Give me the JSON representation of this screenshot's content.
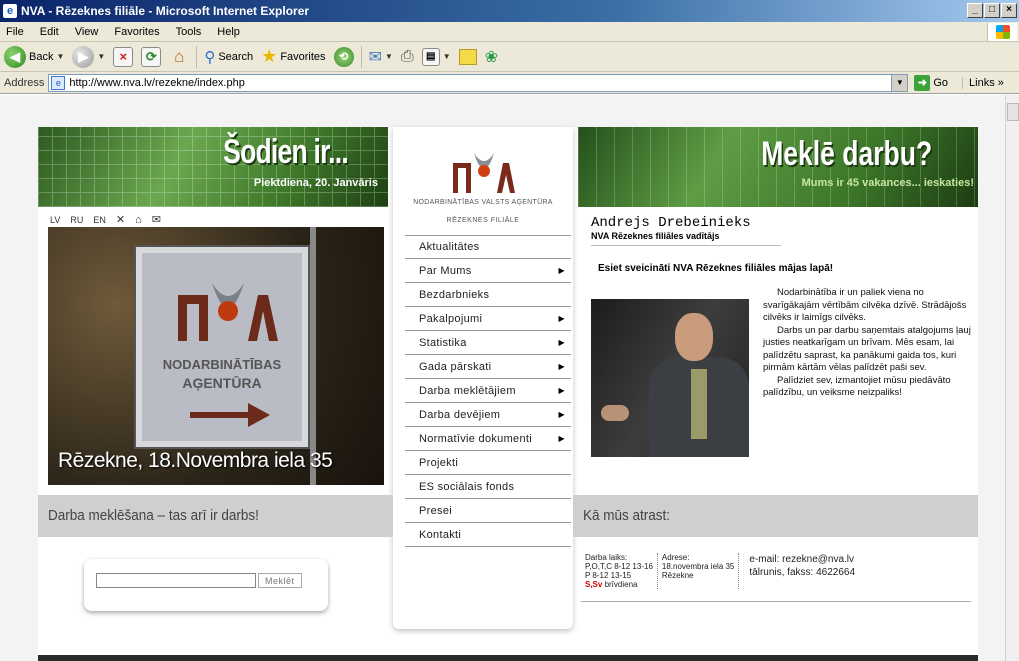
{
  "window": {
    "title": "NVA - Rēzeknes filiāle - Microsoft Internet Explorer",
    "controls": [
      "_",
      "□",
      "×"
    ]
  },
  "menubar": [
    "File",
    "Edit",
    "View",
    "Favorites",
    "Tools",
    "Help"
  ],
  "toolbar": {
    "back": "Back",
    "search": "Search",
    "favorites": "Favorites"
  },
  "address": {
    "label": "Address",
    "url": "http://www.nva.lv/rezekne/index.php",
    "go": "Go",
    "links": "Links"
  },
  "header_left": {
    "title": "Šodien ir...",
    "date": "Piektdiena, 20. Janvāris"
  },
  "header_right": {
    "title": "Meklē darbu?",
    "tagline": "Mums ir 45 vakances... ieskaties!"
  },
  "languages": [
    "LV",
    "RU",
    "EN"
  ],
  "logo": {
    "agency": "NODARBINĀTĪBAS VALSTS AĢENTŪRA",
    "branch": "RĒZEKNES FILIĀLE"
  },
  "sign": {
    "line1": "NODARBINĀTĪBAS",
    "line2": "AĢENTŪRA",
    "caption": "Rēzekne, 18.Novembra iela 35"
  },
  "nav": [
    {
      "label": "Aktualitātes",
      "submenu": false
    },
    {
      "label": "Par Mums",
      "submenu": true
    },
    {
      "label": "Bezdarbnieks",
      "submenu": false
    },
    {
      "label": "Pakalpojumi",
      "submenu": true
    },
    {
      "label": "Statistika",
      "submenu": true
    },
    {
      "label": "Gada pārskati",
      "submenu": true
    },
    {
      "label": "Darba meklētājiem",
      "submenu": true
    },
    {
      "label": "Darba devējiem",
      "submenu": true
    },
    {
      "label": "Normatīvie dokumenti",
      "submenu": true
    },
    {
      "label": "Projekti",
      "submenu": false
    },
    {
      "label": "ES sociālais fonds",
      "submenu": false
    },
    {
      "label": "Presei",
      "submenu": false
    },
    {
      "label": "Kontakti",
      "submenu": false
    }
  ],
  "person": {
    "name": "Andrejs Drebeinieks",
    "role": "NVA Rēzeknes filiāles vadītājs"
  },
  "welcome": "Esiet sveicināti NVA Rēzeknes filiāles mājas lapā!",
  "bio": {
    "p1": "Nodarbinātība ir un paliek viena no svarīgākajām vērtībām cilvēka dzīvē. Strādājošs cilvēks ir laimīgs cilvēks.",
    "p2": "Darbs un par darbu saņemtais atalgojums ļauj justies neatkarīgam un brīvam. Mēs esam, lai palīdzētu saprast, ka panākumi gaida tos, kuri pirmām kārtām vēlas palīdzēt paši sev.",
    "p3": "Palīdziet sev, izmantojiet mūsu piedāvāto palīdzību, un veiksme neizpaliks!"
  },
  "bars": {
    "left": "Darba meklēšana – tas arī ir darbs!",
    "right": "Kā mūs atrast:"
  },
  "search": {
    "value": "",
    "button": "Meklēt"
  },
  "contact": {
    "hours_label": "Darba laiks:",
    "hours_1": "P,O,T,C  8-12 13-16",
    "hours_2": "P  8-12 13-15",
    "hours_off_days": "S,Sv",
    "hours_off_text": " brīvdiena",
    "address_label": "Adrese:",
    "address_1": "18.novembra iela 35",
    "address_2": "Rēzekne",
    "email": "e-mail: rezekne@nva.lv",
    "phone": "tālrunis, fakss: 4622664"
  }
}
